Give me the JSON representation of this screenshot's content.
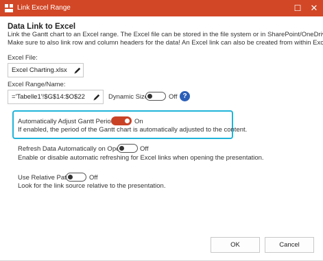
{
  "window": {
    "title": "Link Excel Range",
    "maximize_glyph": "☐",
    "close_glyph": "✕",
    "title_bar_color": "#d24726",
    "app_icon": "think-cell-icon"
  },
  "header": {
    "title": "Data Link to Excel",
    "description_line1": "Link the Gantt chart to an Excel range. The Excel file can be stored in the file system or in SharePoint/OneDrive.",
    "description_line2": "Make sure to also link row and column headers for the data! An Excel link can also be created from within Excel."
  },
  "excel_file": {
    "label": "Excel File:",
    "value": "Excel Charting.xlsx",
    "edit_icon": "pencil-icon"
  },
  "excel_range": {
    "label": "Excel Range/Name:",
    "value": "='Tabelle1'!$G$14:$O$22",
    "edit_icon": "pencil-icon",
    "dynamic_size_label": "Dynamic Size",
    "dynamic_size_state": "Off",
    "help_glyph": "?"
  },
  "auto_adjust": {
    "label": "Automatically Adjust Gantt Period",
    "state": "On",
    "description": "If enabled, the period of the Gantt chart is automatically adjusted to the content.",
    "highlight_color": "#1fb3d9"
  },
  "refresh": {
    "label": "Refresh Data Automatically on Open",
    "state": "Off",
    "description": "Enable or disable automatic refreshing for Excel links when opening the presentation."
  },
  "relative_path": {
    "label": "Use Relative Path",
    "state": "Off",
    "description": "Look for the link source relative to the presentation."
  },
  "buttons": {
    "ok": "OK",
    "cancel": "Cancel"
  },
  "colors": {
    "toggle_on": "#c94226",
    "help_badge": "#2b5fb8"
  }
}
